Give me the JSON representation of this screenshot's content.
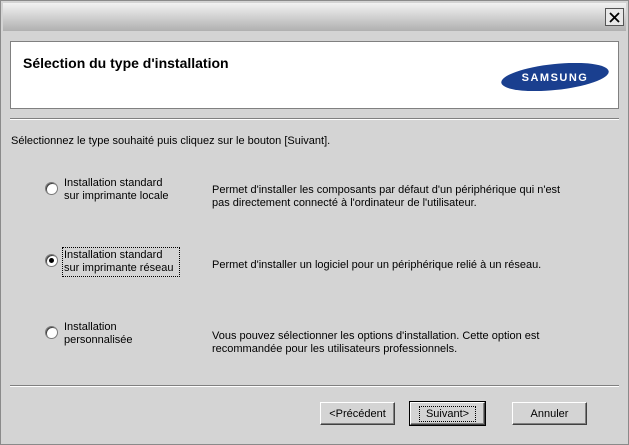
{
  "window": {
    "close_icon": "close-icon"
  },
  "header": {
    "title": "Sélection du type d'installation",
    "logo_text": "SAMSUNG"
  },
  "instruction": "Sélectionnez le type souhaité puis cliquez sur le bouton [Suivant].",
  "options": [
    {
      "label_line1": "Installation standard",
      "label_line2": "sur imprimante locale",
      "description_line1": "Permet d'installer les composants par défaut d'un périphérique qui n'est",
      "description_line2": "pas directement connecté à l'ordinateur de l'utilisateur.",
      "selected": false
    },
    {
      "label_line1": "Installation standard",
      "label_line2": "sur imprimante réseau",
      "description_line1": "Permet d'installer un logiciel pour un périphérique relié à un réseau.",
      "description_line2": "",
      "selected": true
    },
    {
      "label_line1": "Installation",
      "label_line2": "personnalisée",
      "description_line1": "Vous pouvez sélectionner les options d'installation. Cette option est",
      "description_line2": "recommandée pour les utilisateurs professionnels.",
      "selected": false
    }
  ],
  "buttons": {
    "previous": "<Précédent",
    "next": "Suivant>",
    "cancel": "Annuler"
  },
  "colors": {
    "logo_blue": "#1a3f8f",
    "window_bg": "#d4d4d4"
  }
}
